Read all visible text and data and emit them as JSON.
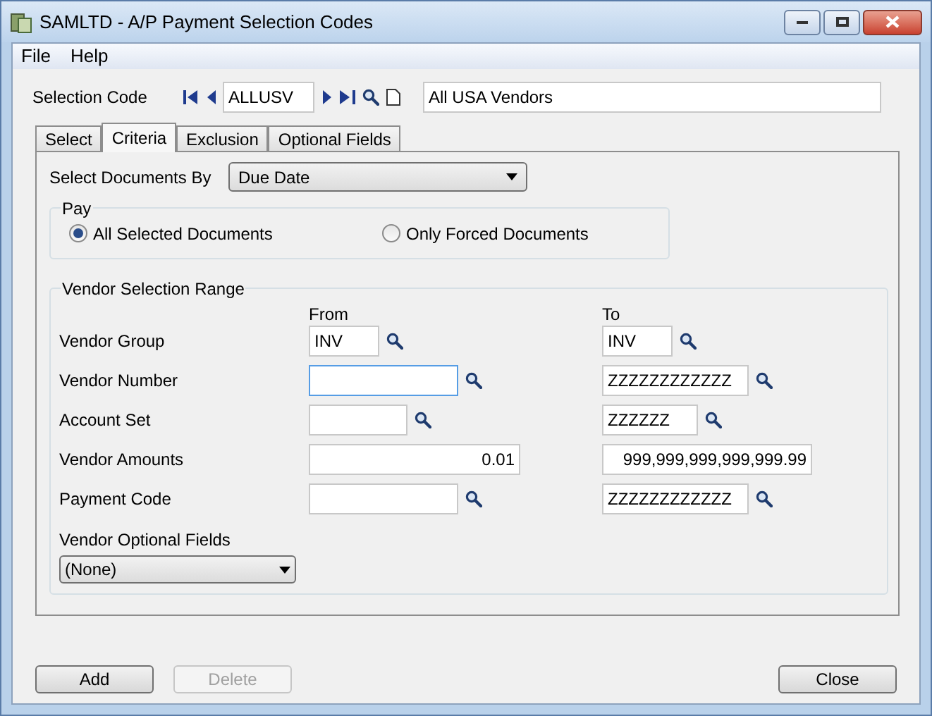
{
  "window": {
    "title": "SAMLTD - A/P Payment Selection Codes"
  },
  "menu": [
    "File",
    "Help"
  ],
  "selection_code": {
    "label": "Selection Code",
    "value": "ALLUSV",
    "description": "All USA Vendors"
  },
  "tabs": [
    {
      "label": "Select",
      "selected": false
    },
    {
      "label": "Criteria",
      "selected": true
    },
    {
      "label": "Exclusion",
      "selected": false
    },
    {
      "label": "Optional Fields",
      "selected": false
    }
  ],
  "select_documents_by": {
    "label": "Select Documents By",
    "value": "Due Date"
  },
  "pay": {
    "title": "Pay",
    "options": [
      {
        "label": "All Selected Documents",
        "selected": true
      },
      {
        "label": "Only Forced Documents",
        "selected": false
      }
    ]
  },
  "vendor_range": {
    "title": "Vendor Selection Range",
    "from_label": "From",
    "to_label": "To",
    "rows": [
      {
        "label": "Vendor Group",
        "kind": "group",
        "from": {
          "value": "INV",
          "focused": false
        },
        "to": {
          "value": "INV",
          "focused": false
        }
      },
      {
        "label": "Vendor Number",
        "kind": "number",
        "from": {
          "focused": true
        },
        "to": {
          "value": "ZZZZZZZZZZZZ",
          "focused": false
        }
      },
      {
        "label": "Account Set",
        "kind": "set",
        "from": {
          "focused": false
        },
        "to": {
          "value": "ZZZZZZ",
          "focused": false
        }
      },
      {
        "label": "Vendor Amounts",
        "kind": "amount",
        "from": {
          "value": "0.01",
          "focused": false
        },
        "to": {
          "value": "999,999,999,999,999.99",
          "focused": false
        }
      },
      {
        "label": "Payment Code",
        "kind": "number",
        "from": {
          "focused": false
        },
        "to": {
          "value": "ZZZZZZZZZZZZ",
          "focused": false
        }
      }
    ],
    "optional_fields": {
      "label": "Vendor Optional Fields",
      "value": "(None)"
    }
  },
  "buttons": [
    {
      "label": "Add",
      "disabled": false
    },
    {
      "label": "Delete",
      "disabled": true
    },
    {
      "label": "Close",
      "disabled": false
    }
  ]
}
